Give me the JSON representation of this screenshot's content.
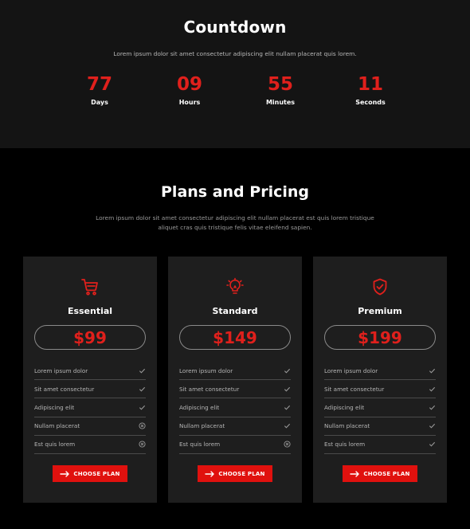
{
  "countdown": {
    "title": "Countdown",
    "subtitle": "Lorem ipsum dolor sit amet consectetur adipiscing elit nullam placerat quis lorem.",
    "units": [
      {
        "value": "77",
        "label": "Days"
      },
      {
        "value": "09",
        "label": "Hours"
      },
      {
        "value": "55",
        "label": "Minutes"
      },
      {
        "value": "11",
        "label": "Seconds"
      }
    ]
  },
  "pricing": {
    "title": "Plans and Pricing",
    "subtitle_line1": "Lorem ipsum dolor sit amet consectetur adipiscing elit nullam placerat est quis lorem tristique",
    "subtitle_line2": "aliquet cras quis tristique felis vitae eleifend sapien.",
    "plans": [
      {
        "icon": "cart-icon",
        "name": "Essential",
        "price": "$99",
        "features": [
          {
            "text": "Lorem ipsum dolor",
            "included": true
          },
          {
            "text": "Sit amet consectetur",
            "included": true
          },
          {
            "text": "Adipiscing elit",
            "included": true
          },
          {
            "text": "Nullam placerat",
            "included": false
          },
          {
            "text": "Est quis lorem",
            "included": false
          }
        ],
        "cta": "CHOOSE PLAN"
      },
      {
        "icon": "lightbulb-icon",
        "name": "Standard",
        "price": "$149",
        "features": [
          {
            "text": "Lorem ipsum dolor",
            "included": true
          },
          {
            "text": "Sit amet consectetur",
            "included": true
          },
          {
            "text": "Adipiscing elit",
            "included": true
          },
          {
            "text": "Nullam placerat",
            "included": true
          },
          {
            "text": "Est quis lorem",
            "included": false
          }
        ],
        "cta": "CHOOSE PLAN"
      },
      {
        "icon": "shield-check-icon",
        "name": "Premium",
        "price": "$199",
        "features": [
          {
            "text": "Lorem ipsum dolor",
            "included": true
          },
          {
            "text": "Sit amet consectetur",
            "included": true
          },
          {
            "text": "Adipiscing elit",
            "included": true
          },
          {
            "text": "Nullam placerat",
            "included": true
          },
          {
            "text": "Est quis lorem",
            "included": true
          }
        ],
        "cta": "CHOOSE PLAN"
      }
    ]
  },
  "colors": {
    "accent": "#e0201c",
    "button": "#e0110e",
    "card_bg": "#1e1e1e",
    "countdown_bg": "#141414",
    "page_bg": "#000000"
  }
}
